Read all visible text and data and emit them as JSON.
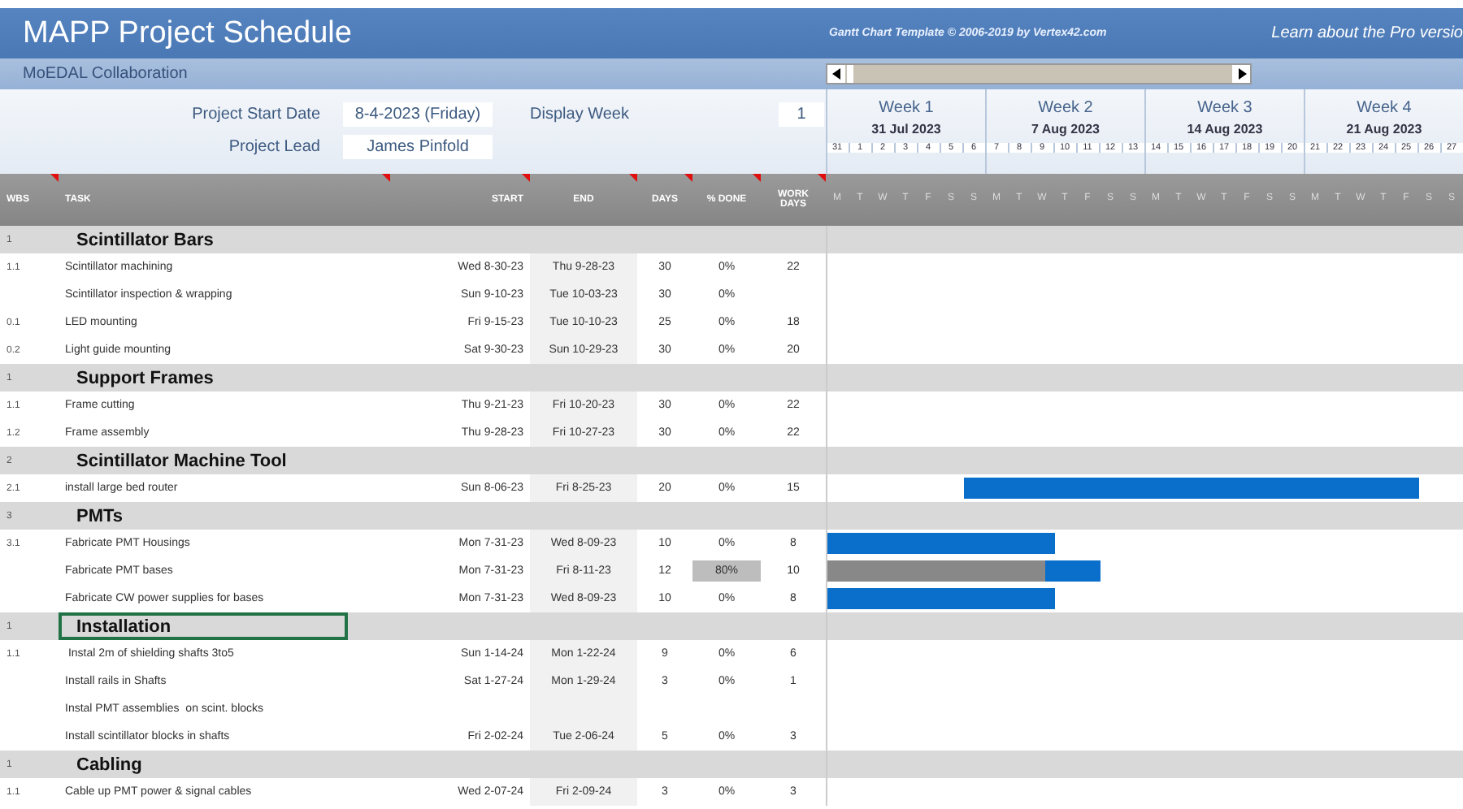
{
  "title": "MAPP Project Schedule",
  "credit": "Gantt Chart Template © 2006-2019 by Vertex42.com",
  "pro_link": "Learn about the Pro versio",
  "subtitle": "MoEDAL Collaboration",
  "fields": [
    {
      "label": "Project Start Date",
      "value": "8-4-2023 (Friday)"
    },
    {
      "label": "Project Lead",
      "value": "James Pinfold"
    }
  ],
  "display_week": {
    "label": "Display Week",
    "value": "1"
  },
  "weeks": [
    {
      "label": "Week 1",
      "date": "31 Jul 2023",
      "days": [
        "31",
        "1",
        "2",
        "3",
        "4",
        "5",
        "6"
      ],
      "letters": [
        "M",
        "T",
        "W",
        "T",
        "F",
        "S",
        "S"
      ]
    },
    {
      "label": "Week 2",
      "date": "7 Aug 2023",
      "days": [
        "7",
        "8",
        "9",
        "10",
        "11",
        "12",
        "13"
      ],
      "letters": [
        "M",
        "T",
        "W",
        "T",
        "F",
        "S",
        "S"
      ]
    },
    {
      "label": "Week 3",
      "date": "14 Aug 2023",
      "days": [
        "14",
        "15",
        "16",
        "17",
        "18",
        "19",
        "20"
      ],
      "letters": [
        "M",
        "T",
        "W",
        "T",
        "F",
        "S",
        "S"
      ]
    },
    {
      "label": "Week 4",
      "date": "21 Aug 2023",
      "days": [
        "21",
        "22",
        "23",
        "24",
        "25",
        "26",
        "27"
      ],
      "letters": [
        "M",
        "T",
        "W",
        "T",
        "F",
        "S",
        "S"
      ]
    }
  ],
  "columns": [
    "WBS",
    "TASK",
    "START",
    "END",
    "DAYS",
    "% DONE",
    "WORK DAYS"
  ],
  "rows": [
    {
      "kind": "group",
      "wbs": "1",
      "task": "Scintillator Bars",
      "selected": false
    },
    {
      "kind": "task",
      "wbs": "1.1",
      "task": "Scintillator machining",
      "start": "Wed 8-30-23",
      "end": "Thu 9-28-23",
      "days": "30",
      "done": "0%",
      "work_days": "22"
    },
    {
      "kind": "task",
      "task": "Scintillator inspection & wrapping",
      "start": "Sun 9-10-23",
      "end": "Tue 10-03-23",
      "days": "30",
      "done": "0%"
    },
    {
      "kind": "task",
      "wbs": "0.1",
      "task": "LED mounting",
      "start": "Fri 9-15-23",
      "end": "Tue 10-10-23",
      "days": "25",
      "done": "0%",
      "work_days": "18"
    },
    {
      "kind": "task",
      "wbs": "0.2",
      "task": "Light guide mounting",
      "start": "Sat 9-30-23",
      "end": "Sun 10-29-23",
      "days": "30",
      "done": "0%",
      "work_days": "20"
    },
    {
      "kind": "group",
      "wbs": "1",
      "task": "Support Frames",
      "selected": false
    },
    {
      "kind": "task",
      "wbs": "1.1",
      "task": "Frame cutting",
      "start": "Thu 9-21-23",
      "end": "Fri 10-20-23",
      "days": "30",
      "done": "0%",
      "work_days": "22"
    },
    {
      "kind": "task",
      "wbs": "1.2",
      "task": "Frame assembly",
      "start": "Thu 9-28-23",
      "end": "Fri 10-27-23",
      "days": "30",
      "done": "0%",
      "work_days": "22"
    },
    {
      "kind": "group",
      "wbs": "2",
      "task": "Scintillator Machine Tool",
      "selected": false
    },
    {
      "kind": "task",
      "wbs": "2.1",
      "task": "install large bed router",
      "start": "Sun 8-06-23",
      "end": "Fri 8-25-23",
      "days": "20",
      "done": "0%",
      "work_days": "15"
    },
    {
      "kind": "group",
      "wbs": "3",
      "task": "PMTs",
      "selected": false
    },
    {
      "kind": "task",
      "wbs": "3.1",
      "task": "Fabricate PMT Housings",
      "start": "Mon 7-31-23",
      "end": "Wed 8-09-23",
      "days": "10",
      "done": "0%",
      "work_days": "8"
    },
    {
      "kind": "task",
      "task": "Fabricate PMT bases",
      "start": "Mon 7-31-23",
      "end": "Fri 8-11-23",
      "days": "12",
      "done": "80%",
      "level": 0.8,
      "work_days": "10"
    },
    {
      "kind": "task",
      "task": "Fabricate CW power supplies for bases",
      "start": "Mon 7-31-23",
      "end": "Wed 8-09-23",
      "days": "10",
      "done": "0%",
      "work_days": "8"
    },
    {
      "kind": "group",
      "wbs": "1",
      "task": "Installation",
      "selected": true
    },
    {
      "kind": "task",
      "wbs": "1.1",
      "task": " Instal 2m of shielding shafts 3to5",
      "start": "Sun 1-14-24",
      "end": "Mon 1-22-24",
      "days": "9",
      "done": "0%",
      "work_days": "6"
    },
    {
      "kind": "task",
      "task": "Install rails in Shafts",
      "start": "Sat 1-27-24",
      "end": "Mon 1-29-24",
      "days": "3",
      "done": "0%",
      "work_days": "1"
    },
    {
      "kind": "task",
      "task": "Instal PMT assemblies  on scint. blocks"
    },
    {
      "kind": "task",
      "task": "Install scintillator blocks in shafts",
      "start": "Fri 2-02-24",
      "end": "Tue 2-06-24",
      "days": "5",
      "done": "0%",
      "work_days": "3"
    },
    {
      "kind": "group",
      "wbs": "1",
      "task": "Cabling",
      "selected": false
    },
    {
      "kind": "task",
      "wbs": "1.1",
      "task": "Cable up PMT power & signal cables",
      "start": "Wed 2-07-24",
      "end": "Fri 2-09-24",
      "days": "3",
      "done": "0%",
      "work_days": "3"
    }
  ]
}
